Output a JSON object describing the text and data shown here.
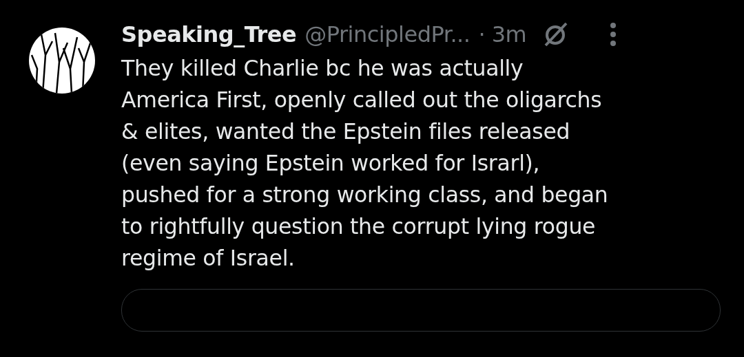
{
  "post": {
    "author_name": "Speaking_Tree",
    "handle": "@PrincipledPr...",
    "time": "· 3m",
    "text": "They killed Charlie bc he was actually\nAmerica First, openly called out the oligarchs\n& elites, wanted the Epstein files released\n(even saying Epstein worked for Israrl),\npushed for a strong working class, and began\nto rightfully question the corrupt lying rogue\nregime of Israel.",
    "quoted_post": {
      "kind": "card"
    }
  }
}
